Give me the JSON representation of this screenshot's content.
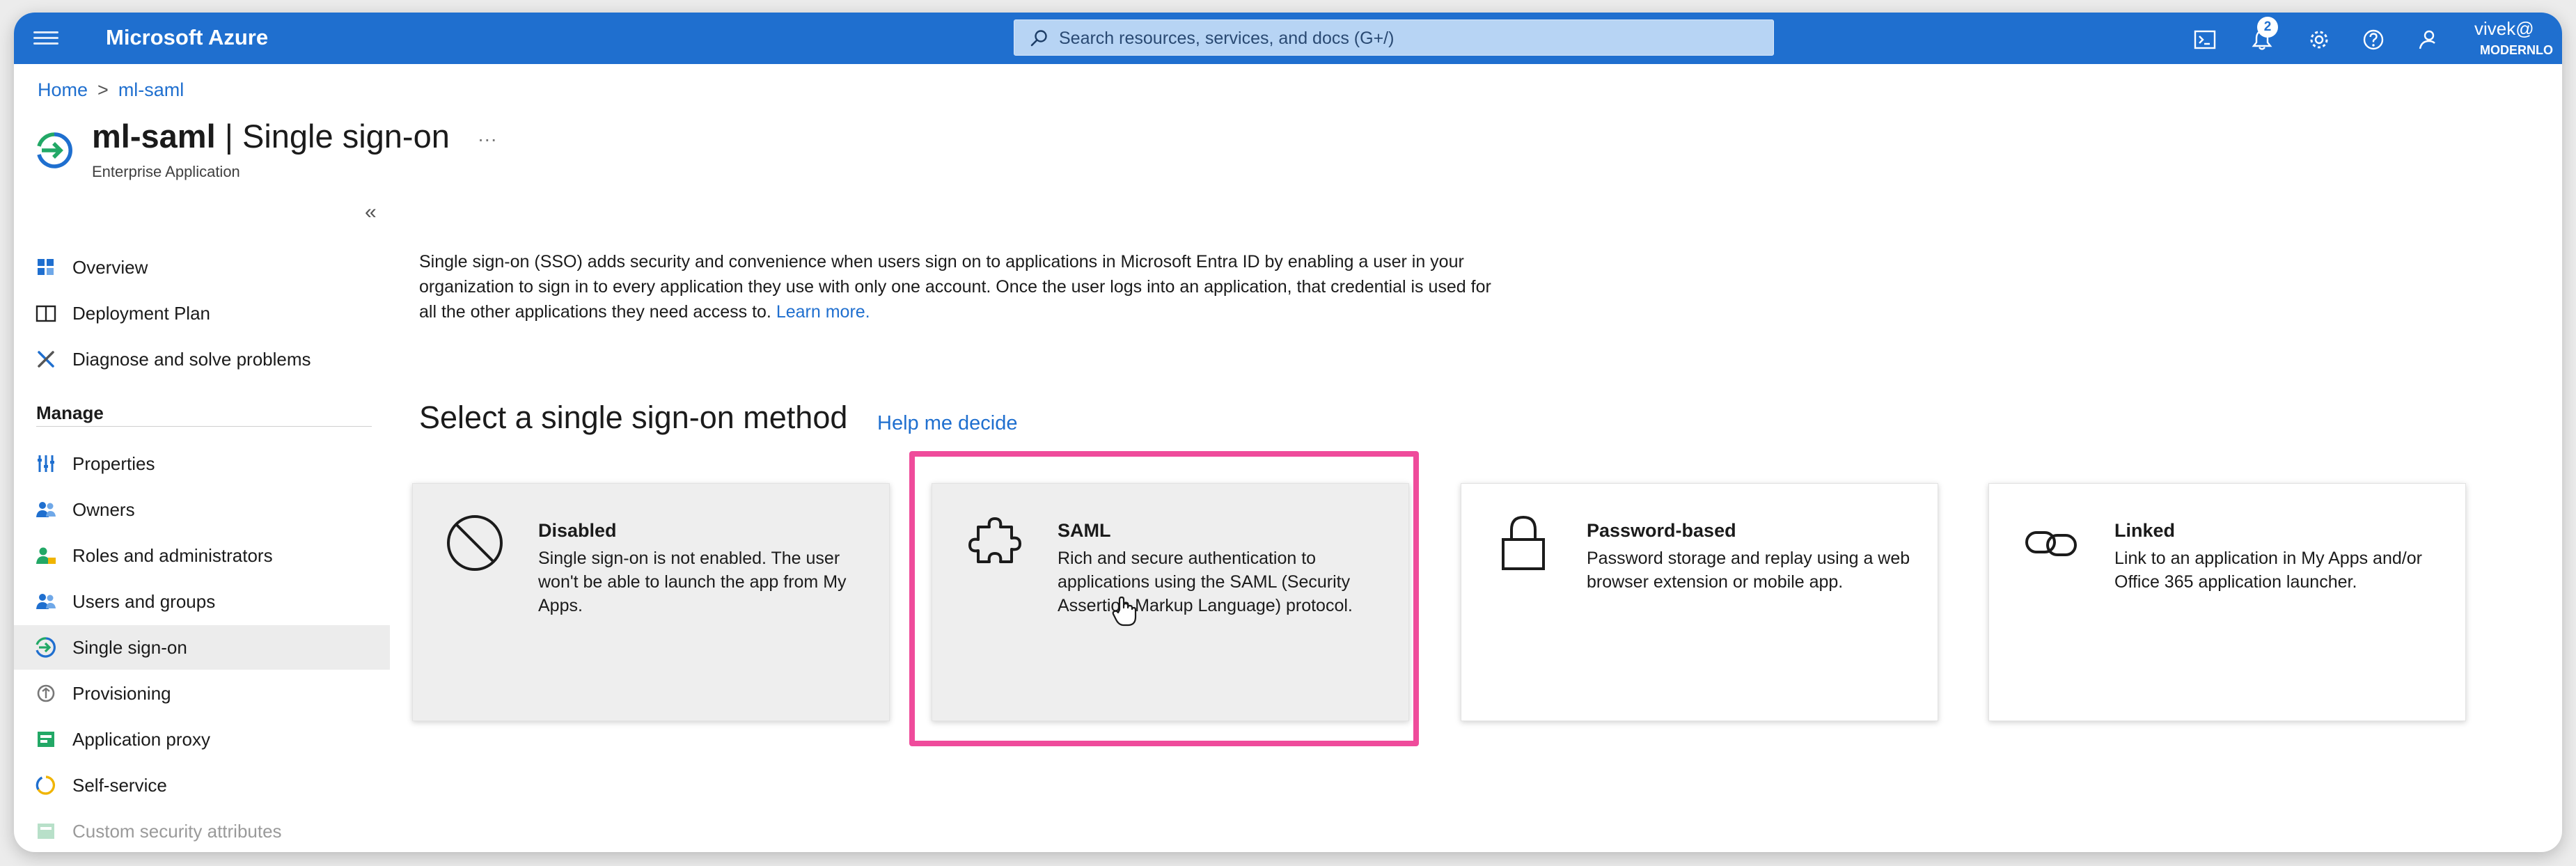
{
  "topbar": {
    "brand": "Microsoft Azure",
    "search_placeholder": "Search resources, services, and docs (G+/)",
    "notification_count": "2",
    "user_name": "vivek@",
    "user_org": "MODERNLO",
    "icons": [
      "menu-icon",
      "cloud-shell-icon",
      "notifications-icon",
      "settings-icon",
      "help-icon",
      "feedback-icon"
    ]
  },
  "breadcrumb": {
    "home": "Home",
    "current": "ml-saml",
    "separator": ">"
  },
  "header": {
    "app_name": "ml-saml",
    "page_name": "Single sign-on",
    "separator": "|",
    "more": "···",
    "subtitle": "Enterprise Application",
    "collapse": "«"
  },
  "sidebar": {
    "top_items": [
      {
        "label": "Overview",
        "icon": "overview-icon"
      },
      {
        "label": "Deployment Plan",
        "icon": "book-icon"
      },
      {
        "label": "Diagnose and solve problems",
        "icon": "wrench-icon"
      }
    ],
    "section": "Manage",
    "items": [
      {
        "label": "Properties",
        "icon": "properties-icon"
      },
      {
        "label": "Owners",
        "icon": "owners-icon"
      },
      {
        "label": "Roles and administrators",
        "icon": "roles-icon"
      },
      {
        "label": "Users and groups",
        "icon": "users-icon"
      },
      {
        "label": "Single sign-on",
        "icon": "sso-icon",
        "active": true
      },
      {
        "label": "Provisioning",
        "icon": "provisioning-icon"
      },
      {
        "label": "Application proxy",
        "icon": "app-proxy-icon"
      },
      {
        "label": "Self-service",
        "icon": "self-service-icon"
      },
      {
        "label": "Custom security attributes",
        "icon": "custom-attributes-icon",
        "disabled": true
      }
    ]
  },
  "main": {
    "intro": "Single sign-on (SSO) adds security and convenience when users sign on to applications in Microsoft Entra ID by enabling a user in your organization to sign in to every application they use with only one account. Once the user logs into an application, that credential is used for all the other applications they need access to.",
    "learn_more": "Learn more.",
    "section_title": "Select a single sign-on method",
    "help_link": "Help me decide",
    "cards": [
      {
        "title": "Disabled",
        "desc": "Single sign-on is not enabled. The user won't be able to launch the app from My Apps.",
        "icon": "prohibited-icon"
      },
      {
        "title": "SAML",
        "desc": "Rich and secure authentication to applications using the SAML (Security Assertion Markup Language) protocol.",
        "icon": "puzzle-icon"
      },
      {
        "title": "Password-based",
        "desc": "Password storage and replay using a web browser extension or mobile app.",
        "icon": "lock-icon"
      },
      {
        "title": "Linked",
        "desc": "Link to an application in My Apps and/or Office 365 application launcher.",
        "icon": "link-icon"
      }
    ]
  },
  "colors": {
    "topbar": "#1f6fcf",
    "link": "#1f6fcf",
    "highlight": "#ef4b9b",
    "active_nav": "#ececec"
  }
}
